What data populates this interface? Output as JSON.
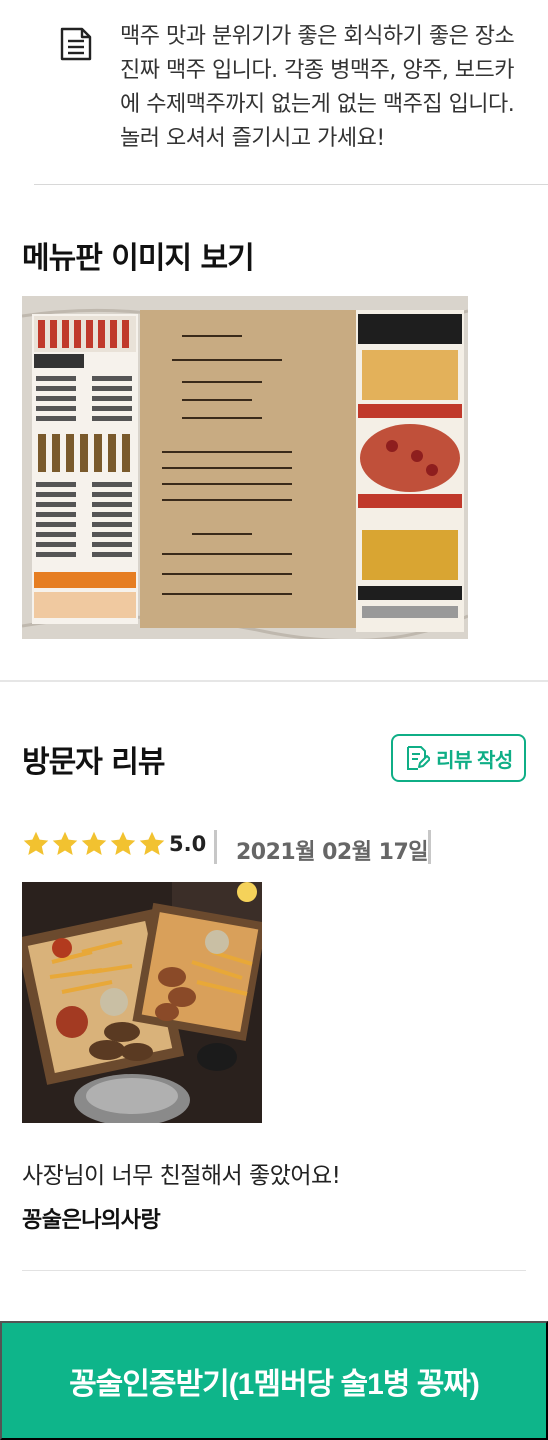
{
  "description": {
    "icon": "document-icon",
    "text": "맥주 맛과 분위기가 좋은 회식하기 좋은 장소 진짜 맥주 입니다. 각종 병맥주, 양주, 보드카에 수제맥주까지 없는게 없는 맥주집 입니다. 놀러 오셔서 즐기시고 가세요!"
  },
  "menu_section": {
    "title": "메뉴판 이미지 보기",
    "menu_image_alt": "menu-board-photo"
  },
  "review_section": {
    "title": "방문자 리뷰",
    "write_button": "리뷰 작성",
    "accent_color": "#0fae86",
    "star_color": "#f2c230"
  },
  "review": {
    "stars": 5,
    "rating": "5.0",
    "date": "2021월 02월 17일",
    "text": "사장님이 너무 친절해서 좋았어요!",
    "author": "꽁술은나의사랑"
  },
  "cta": {
    "label": "꽁술인증받기(1멤버당 술1병 꽁짜)",
    "color": "#0eb58a"
  }
}
